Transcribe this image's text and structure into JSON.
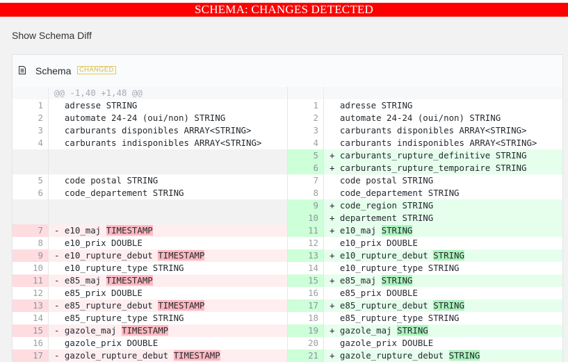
{
  "banner": {
    "text": "SCHEMA: CHANGES DETECTED"
  },
  "toggle": {
    "label": "Show Schema Diff"
  },
  "panel": {
    "icon": "file-text-icon",
    "title": "Schema",
    "badge": "CHANGED"
  },
  "colors": {
    "banner": "#ff0000",
    "deleted": "#ffeef0",
    "deleted_highlight": "#fdb8c0",
    "added": "#e6ffed",
    "added_highlight": "#acf2bd"
  },
  "diff": {
    "hunk_header": "@@ -1,40 +1,48 @@",
    "rows": [
      {
        "type": "same",
        "left_num": "1",
        "right_num": "1",
        "text": "adresse STRING"
      },
      {
        "type": "same",
        "left_num": "2",
        "right_num": "2",
        "text": "automate 24-24 (oui/non) STRING"
      },
      {
        "type": "same",
        "left_num": "3",
        "right_num": "3",
        "text": "carburants disponibles ARRAY<STRING>"
      },
      {
        "type": "same",
        "left_num": "4",
        "right_num": "4",
        "text": "carburants indisponibles ARRAY<STRING>"
      },
      {
        "type": "add",
        "right_num": "5",
        "right_text": "carburants_rupture_definitive STRING"
      },
      {
        "type": "add",
        "right_num": "6",
        "right_text": "carburants_rupture_temporaire STRING"
      },
      {
        "type": "same",
        "left_num": "5",
        "right_num": "7",
        "text": "code postal STRING"
      },
      {
        "type": "same",
        "left_num": "6",
        "right_num": "8",
        "text": "code_departement STRING"
      },
      {
        "type": "add",
        "right_num": "9",
        "right_text": "code_region STRING"
      },
      {
        "type": "add",
        "right_num": "10",
        "right_text": "departement STRING"
      },
      {
        "type": "change",
        "left_num": "7",
        "right_num": "11",
        "name": "e10_maj",
        "old_type": "TIMESTAMP",
        "new_type": "STRING"
      },
      {
        "type": "same",
        "left_num": "8",
        "right_num": "12",
        "text": "e10_prix DOUBLE"
      },
      {
        "type": "change",
        "left_num": "9",
        "right_num": "13",
        "name": "e10_rupture_debut",
        "old_type": "TIMESTAMP",
        "new_type": "STRING"
      },
      {
        "type": "same",
        "left_num": "10",
        "right_num": "14",
        "text": "e10_rupture_type STRING"
      },
      {
        "type": "change",
        "left_num": "11",
        "right_num": "15",
        "name": "e85_maj",
        "old_type": "TIMESTAMP",
        "new_type": "STRING"
      },
      {
        "type": "same",
        "left_num": "12",
        "right_num": "16",
        "text": "e85_prix DOUBLE"
      },
      {
        "type": "change",
        "left_num": "13",
        "right_num": "17",
        "name": "e85_rupture_debut",
        "old_type": "TIMESTAMP",
        "new_type": "STRING"
      },
      {
        "type": "same",
        "left_num": "14",
        "right_num": "18",
        "text": "e85_rupture_type STRING"
      },
      {
        "type": "change",
        "left_num": "15",
        "right_num": "19",
        "name": "gazole_maj",
        "old_type": "TIMESTAMP",
        "new_type": "STRING"
      },
      {
        "type": "same",
        "left_num": "16",
        "right_num": "20",
        "text": "gazole_prix DOUBLE"
      },
      {
        "type": "change",
        "left_num": "17",
        "right_num": "21",
        "name": "gazole_rupture_debut",
        "old_type": "TIMESTAMP",
        "new_type": "STRING"
      }
    ]
  }
}
